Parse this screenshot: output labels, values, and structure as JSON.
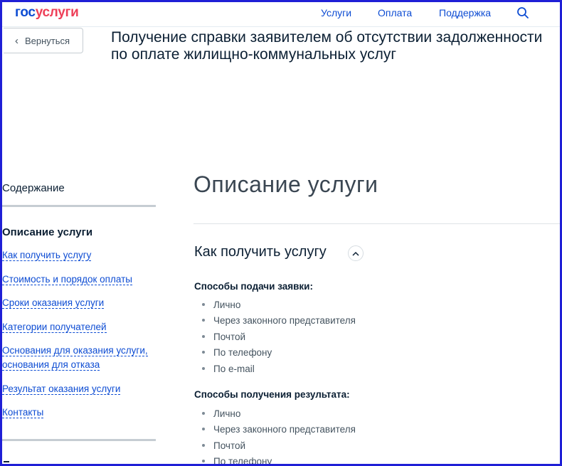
{
  "header": {
    "logo_part1": "гос",
    "logo_part2": "услуги",
    "nav": [
      "Услуги",
      "Оплата",
      "Поддержка"
    ]
  },
  "back_label": "Вернуться",
  "title_lines": [
    "Получение справки заявителем об отсутствии задолженности",
    "по оплате жилищно-коммунальных услуг"
  ],
  "sidebar": {
    "heading": "Содержание",
    "active": "Описание услуги",
    "links": [
      "Как получить услугу",
      "Стоимость и порядок оплаты",
      "Сроки оказания услуги",
      "Категории получателей",
      "Основания для оказания услуги,",
      "основания для отказа",
      "Результат оказания услуги",
      "Контакты"
    ]
  },
  "main": {
    "heading": "Описание услуги",
    "section_title": "Как получить услугу",
    "submit_title": "Способы подачи заявки:",
    "submit_items": [
      "Лично",
      "Через законного представителя",
      "Почтой",
      "По телефону",
      "По e-mail"
    ],
    "result_title": "Способы получения результата:",
    "result_items": [
      "Лично",
      "Через законного представителя",
      "Почтой",
      "По телефону"
    ]
  },
  "icons": {
    "search": "search-icon",
    "back": "chevron-left-icon",
    "toggle": "chevron-up-icon"
  },
  "colors": {
    "accent": "#0d4cd3",
    "logo_red": "#ee3f58",
    "frame": "#1f1fd6"
  }
}
